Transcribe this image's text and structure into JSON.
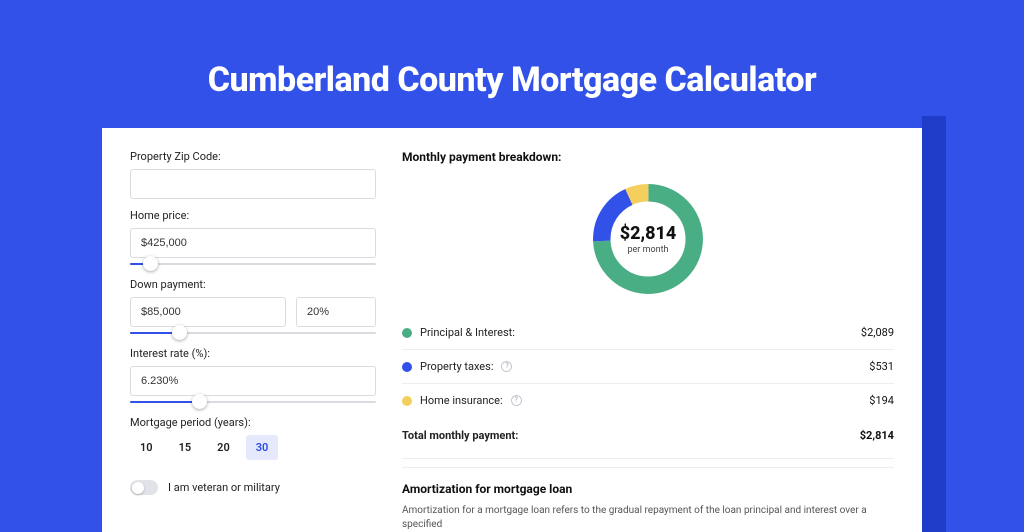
{
  "title": "Cumberland County Mortgage Calculator",
  "form": {
    "zip_label": "Property Zip Code:",
    "zip_value": "",
    "home_price_label": "Home price:",
    "home_price_value": "$425,000",
    "down_payment_label": "Down payment:",
    "down_payment_value": "$85,000",
    "down_payment_pct": "20%",
    "interest_label": "Interest rate (%):",
    "interest_value": "6.230%",
    "period_label": "Mortgage period (years):",
    "period_options": [
      "10",
      "15",
      "20",
      "30"
    ],
    "period_selected": "30",
    "veteran_label": "I am veteran or military"
  },
  "sliders": {
    "home_price_pct": 8,
    "down_payment_pct": 20,
    "interest_pct": 28
  },
  "breakdown": {
    "title": "Monthly payment breakdown:",
    "center_amount": "$2,814",
    "center_sub": "per month",
    "items": [
      {
        "swatch": "sw-green",
        "label": "Principal & Interest:",
        "info": false,
        "amount": "$2,089"
      },
      {
        "swatch": "sw-blue",
        "label": "Property taxes:",
        "info": true,
        "amount": "$531"
      },
      {
        "swatch": "sw-yellow",
        "label": "Home insurance:",
        "info": true,
        "amount": "$194"
      }
    ],
    "total_label": "Total monthly payment:",
    "total_amount": "$2,814"
  },
  "amort": {
    "title": "Amortization for mortgage loan",
    "text": "Amortization for a mortgage loan refers to the gradual repayment of the loan principal and interest over a specified"
  },
  "chart_data": {
    "type": "pie",
    "title": "Monthly payment breakdown",
    "series": [
      {
        "name": "Principal & Interest",
        "value": 2089,
        "color": "#4aae84"
      },
      {
        "name": "Property taxes",
        "value": 531,
        "color": "#3151e8"
      },
      {
        "name": "Home insurance",
        "value": 194,
        "color": "#f4cf5e"
      }
    ],
    "total": 2814,
    "center_label": "$2,814 per month"
  }
}
